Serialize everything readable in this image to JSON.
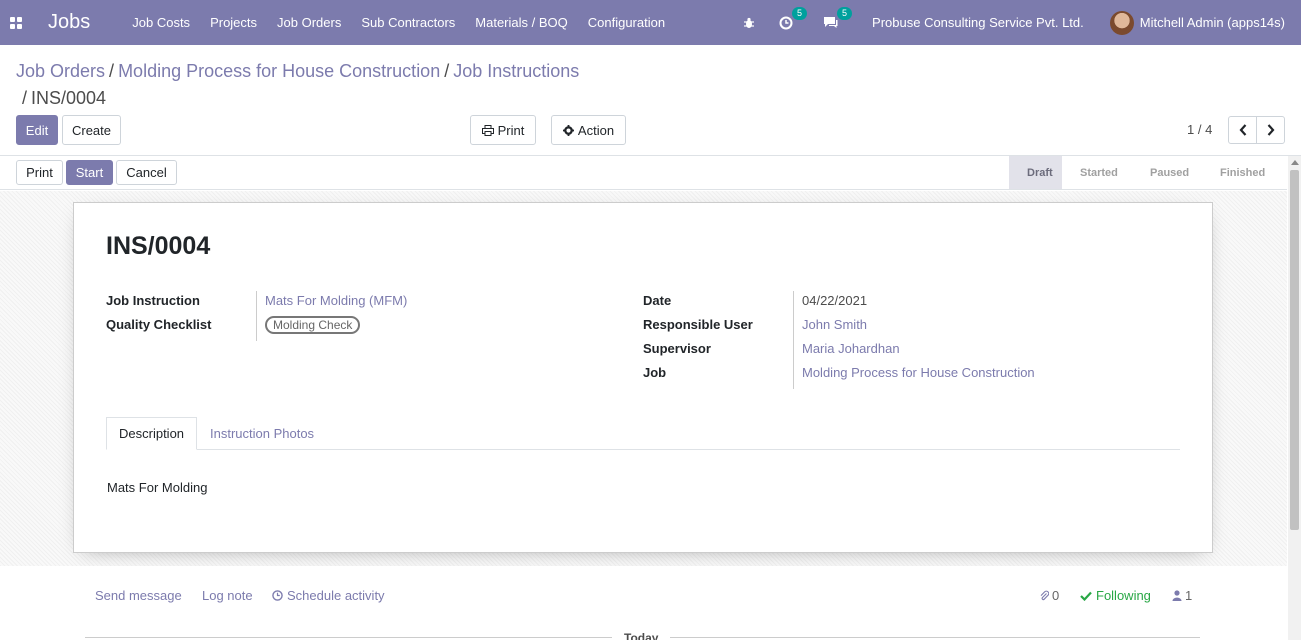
{
  "navbar": {
    "app_name": "Jobs",
    "menu": [
      "Job Costs",
      "Projects",
      "Job Orders",
      "Sub Contractors",
      "Materials / BOQ",
      "Configuration"
    ],
    "activity_count": "5",
    "message_count": "5",
    "company": "Probuse Consulting Service Pvt. Ltd.",
    "user": "Mitchell Admin (apps14s)",
    "bg_color": "#7c7bad"
  },
  "breadcrumb": {
    "items": [
      "Job Orders",
      "Molding Process for House Construction",
      "Job Instructions"
    ],
    "current": "INS/0004"
  },
  "control": {
    "edit_label": "Edit",
    "create_label": "Create",
    "print_label": "Print",
    "action_label": "Action",
    "pager": "1 / 4"
  },
  "statusbar": {
    "print_label": "Print",
    "start_label": "Start",
    "cancel_label": "Cancel",
    "stages": [
      "Draft",
      "Started",
      "Paused",
      "Finished"
    ],
    "active_stage": "Draft"
  },
  "form": {
    "title": "INS/0004",
    "left": [
      {
        "label": "Job Instruction",
        "value": "Mats For Molding (MFM)"
      },
      {
        "label": "Quality Checklist",
        "value": "Molding Check"
      }
    ],
    "right": [
      {
        "label": "Date",
        "value": "04/22/2021"
      },
      {
        "label": "Responsible User",
        "value": "John Smith"
      },
      {
        "label": "Supervisor",
        "value": "Maria Johardhan"
      },
      {
        "label": "Job",
        "value": "Molding Process for House Construction"
      }
    ],
    "tabs": [
      "Description",
      "Instruction Photos"
    ],
    "description": "Mats For Molding"
  },
  "chatter": {
    "send_message": "Send message",
    "log_note": "Log note",
    "schedule_activity": "Schedule activity",
    "attachments": "0",
    "following": "Following",
    "followers": "1",
    "today": "Today"
  }
}
